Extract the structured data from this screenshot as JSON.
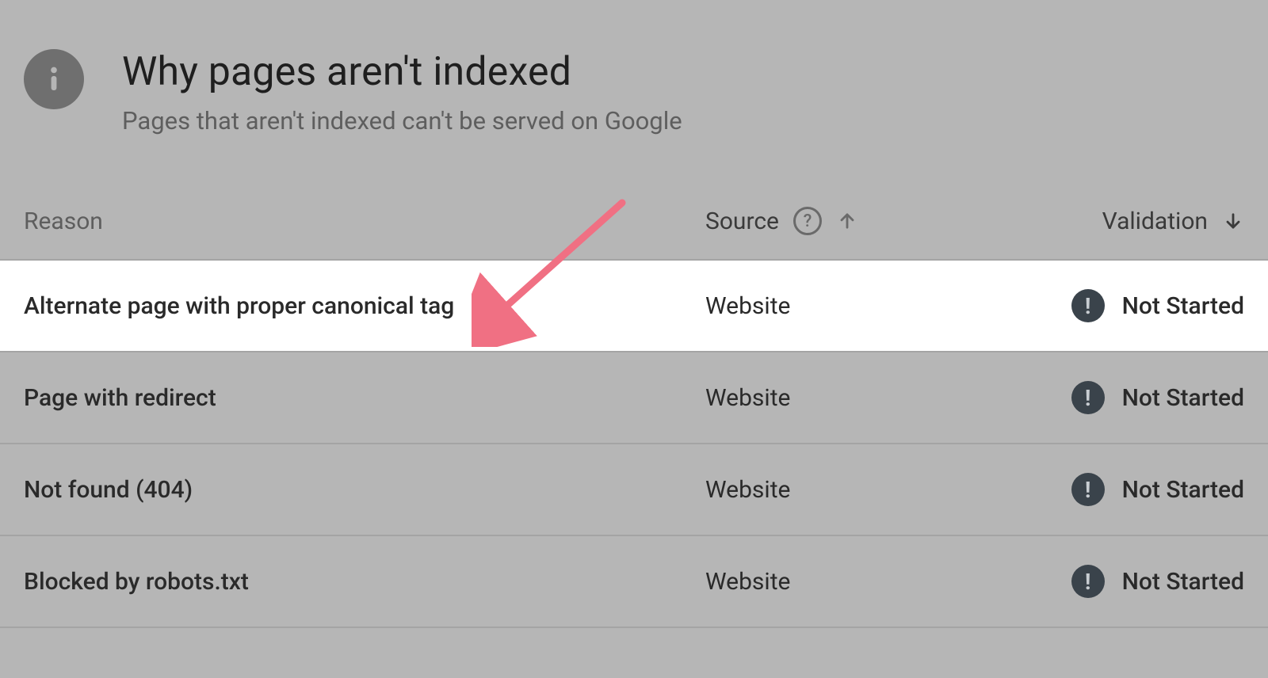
{
  "header": {
    "title": "Why pages aren't indexed",
    "subtitle": "Pages that aren't indexed can't be served on Google"
  },
  "columns": {
    "reason": "Reason",
    "source": "Source",
    "validation": "Validation"
  },
  "rows": [
    {
      "reason": "Alternate page with proper canonical tag",
      "source": "Website",
      "validation": "Not Started",
      "highlight": true
    },
    {
      "reason": "Page with redirect",
      "source": "Website",
      "validation": "Not Started",
      "highlight": false
    },
    {
      "reason": "Not found (404)",
      "source": "Website",
      "validation": "Not Started",
      "highlight": false
    },
    {
      "reason": "Blocked by robots.txt",
      "source": "Website",
      "validation": "Not Started",
      "highlight": false
    }
  ]
}
